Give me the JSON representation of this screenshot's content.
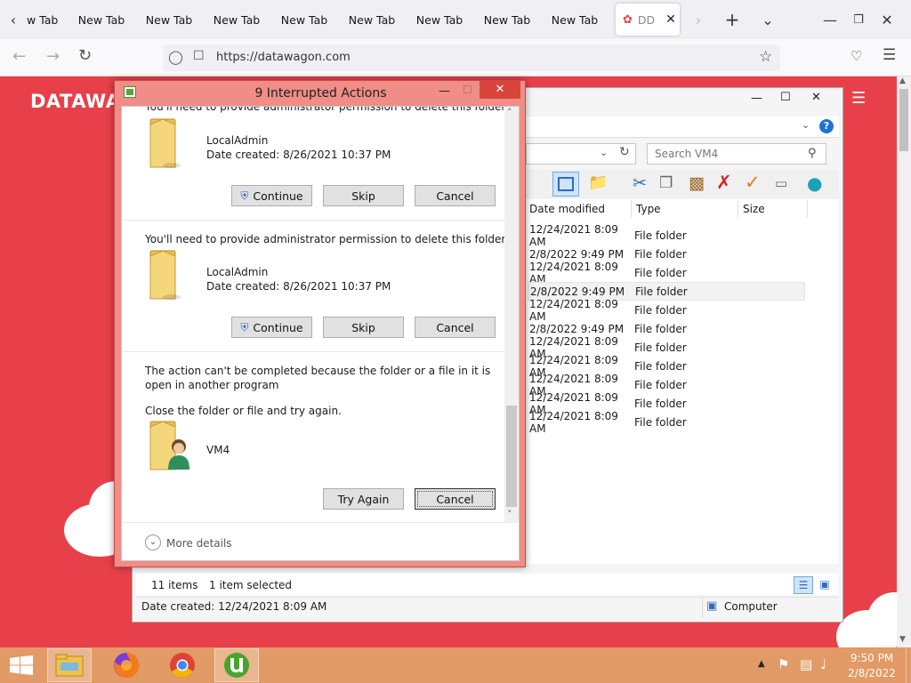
{
  "browser": {
    "tabs": [
      "w Tab",
      "New Tab",
      "New Tab",
      "New Tab",
      "New Tab",
      "New Tab",
      "New Tab",
      "New Tab",
      "New Tab"
    ],
    "active_tab": "DD",
    "url": "https://datawagon.com"
  },
  "site": {
    "logo": "DATAWA"
  },
  "explorer": {
    "search_placeholder": "Search VM4",
    "columns": {
      "date": "Date modified",
      "type": "Type",
      "size": "Size"
    },
    "rows": [
      {
        "date": "12/24/2021 8:09 AM",
        "type": "File folder"
      },
      {
        "date": "2/8/2022 9:49 PM",
        "type": "File folder"
      },
      {
        "date": "12/24/2021 8:09 AM",
        "type": "File folder"
      },
      {
        "date": "2/8/2022 9:49 PM",
        "type": "File folder"
      },
      {
        "date": "12/24/2021 8:09 AM",
        "type": "File folder"
      },
      {
        "date": "2/8/2022 9:49 PM",
        "type": "File folder"
      },
      {
        "date": "12/24/2021 8:09 AM",
        "type": "File folder"
      },
      {
        "date": "12/24/2021 8:09 AM",
        "type": "File folder"
      },
      {
        "date": "12/24/2021 8:09 AM",
        "type": "File folder"
      },
      {
        "date": "12/24/2021 8:09 AM",
        "type": "File folder"
      },
      {
        "date": "12/24/2021 8:09 AM",
        "type": "File folder"
      }
    ],
    "status": {
      "items": "11 items",
      "selected": "1 item selected"
    },
    "details": {
      "date_created": "Date created: 12/24/2021 8:09 AM",
      "location": "Computer"
    }
  },
  "dialog": {
    "title": "9 Interrupted Actions",
    "item1": {
      "message": "You'll need to provide administrator permission to delete this folder",
      "name": "LocalAdmin",
      "date": "Date created: 8/26/2021 10:37 PM",
      "continue": "Continue",
      "skip": "Skip",
      "cancel": "Cancel"
    },
    "item2": {
      "message": "You'll need to provide administrator permission to delete this folder",
      "name": "LocalAdmin",
      "date": "Date created: 8/26/2021 10:37 PM",
      "continue": "Continue",
      "skip": "Skip",
      "cancel": "Cancel"
    },
    "item3": {
      "message": "The action can't be completed because the folder or a file in it is open in another program",
      "hint": "Close the folder or file and try again.",
      "name": "VM4",
      "try_again": "Try Again",
      "cancel": "Cancel"
    },
    "more_details": "More details"
  },
  "taskbar": {
    "time": "9:50 PM",
    "date": "2/8/2022"
  }
}
